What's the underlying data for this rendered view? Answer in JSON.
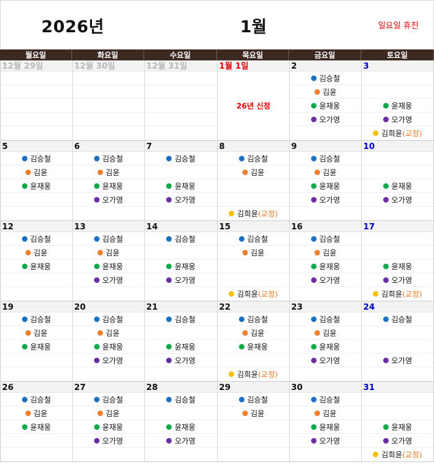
{
  "header": {
    "year": "2026년",
    "month": "1월",
    "note": "일요일 휴진"
  },
  "weekdays": [
    "월요일",
    "화요일",
    "수요일",
    "목요일",
    "금요일",
    "토요일"
  ],
  "staff": {
    "kim_sc": {
      "name": "김승철",
      "color": "#1f6fbf"
    },
    "kim_y": {
      "name": "김윤",
      "color": "#ee7f2d"
    },
    "yoon": {
      "name": "윤재웅",
      "color": "#13a84a"
    },
    "oh": {
      "name": "오가영",
      "color": "#6a2fa0"
    },
    "kim_hy": {
      "name": "김희윤",
      "color": "#f7c000",
      "extra": "(교정)"
    }
  },
  "weeks": [
    [
      {
        "date": "12월 29일",
        "style": "gray",
        "slots": [
          null,
          null,
          null,
          null,
          null
        ]
      },
      {
        "date": "12월 30일",
        "style": "gray",
        "slots": [
          null,
          null,
          null,
          null,
          null
        ]
      },
      {
        "date": "12월 31일",
        "style": "gray",
        "slots": [
          null,
          null,
          null,
          null,
          null
        ]
      },
      {
        "date": "1월 1일",
        "style": "red",
        "holiday": "26년 신정"
      },
      {
        "date": "2",
        "style": "plain",
        "slots": [
          "kim_sc",
          "kim_y",
          "yoon",
          "oh",
          null
        ]
      },
      {
        "date": "3",
        "style": "blue",
        "slots": [
          null,
          null,
          "yoon",
          "oh",
          "kim_hy"
        ]
      }
    ],
    [
      {
        "date": "5",
        "style": "plain",
        "slots": [
          "kim_sc",
          "kim_y",
          "yoon",
          null,
          null
        ]
      },
      {
        "date": "6",
        "style": "plain",
        "slots": [
          "kim_sc",
          "kim_y",
          "yoon",
          "oh",
          null
        ]
      },
      {
        "date": "7",
        "style": "plain",
        "slots": [
          "kim_sc",
          null,
          "yoon",
          "oh",
          null
        ]
      },
      {
        "date": "8",
        "style": "plain",
        "slots": [
          "kim_sc",
          "kim_y",
          null,
          null,
          "kim_hy"
        ]
      },
      {
        "date": "9",
        "style": "plain",
        "slots": [
          "kim_sc",
          "kim_y",
          "yoon",
          "oh",
          null
        ]
      },
      {
        "date": "10",
        "style": "blue",
        "slots": [
          null,
          null,
          "yoon",
          "oh",
          null
        ]
      }
    ],
    [
      {
        "date": "12",
        "style": "plain",
        "slots": [
          "kim_sc",
          "kim_y",
          "yoon",
          null,
          null
        ]
      },
      {
        "date": "13",
        "style": "plain",
        "slots": [
          "kim_sc",
          "kim_y",
          "yoon",
          "oh",
          null
        ]
      },
      {
        "date": "14",
        "style": "plain",
        "slots": [
          "kim_sc",
          null,
          "yoon",
          "oh",
          null
        ]
      },
      {
        "date": "15",
        "style": "plain",
        "slots": [
          "kim_sc",
          "kim_y",
          null,
          null,
          "kim_hy"
        ]
      },
      {
        "date": "16",
        "style": "plain",
        "slots": [
          "kim_sc",
          "kim_y",
          "yoon",
          "oh",
          null
        ]
      },
      {
        "date": "17",
        "style": "blue",
        "slots": [
          null,
          null,
          "yoon",
          "oh",
          "kim_hy"
        ]
      }
    ],
    [
      {
        "date": "19",
        "style": "plain",
        "slots": [
          "kim_sc",
          "kim_y",
          "yoon",
          null,
          null
        ]
      },
      {
        "date": "20",
        "style": "plain",
        "slots": [
          "kim_sc",
          "kim_y",
          "yoon",
          "oh",
          null
        ]
      },
      {
        "date": "21",
        "style": "plain",
        "slots": [
          "kim_sc",
          null,
          "yoon",
          "oh",
          null
        ]
      },
      {
        "date": "22",
        "style": "plain",
        "slots": [
          "kim_sc",
          "kim_y",
          "yoon",
          null,
          "kim_hy"
        ]
      },
      {
        "date": "23",
        "style": "plain",
        "slots": [
          "kim_sc",
          "kim_y",
          "yoon",
          "oh",
          null
        ]
      },
      {
        "date": "24",
        "style": "blue",
        "slots": [
          "kim_sc",
          null,
          null,
          "oh",
          null
        ]
      }
    ],
    [
      {
        "date": "26",
        "style": "plain",
        "slots": [
          "kim_sc",
          "kim_y",
          "yoon",
          null,
          null
        ]
      },
      {
        "date": "27",
        "style": "plain",
        "slots": [
          "kim_sc",
          "kim_y",
          "yoon",
          "oh",
          null
        ]
      },
      {
        "date": "28",
        "style": "plain",
        "slots": [
          "kim_sc",
          null,
          "yoon",
          "oh",
          null
        ]
      },
      {
        "date": "29",
        "style": "plain",
        "slots": [
          "kim_sc",
          "kim_y",
          null,
          null,
          null
        ]
      },
      {
        "date": "30",
        "style": "plain",
        "slots": [
          "kim_sc",
          "kim_y",
          "yoon",
          "oh",
          null
        ]
      },
      {
        "date": "31",
        "style": "blue",
        "slots": [
          null,
          null,
          "yoon",
          "oh",
          "kim_hy"
        ]
      }
    ]
  ]
}
